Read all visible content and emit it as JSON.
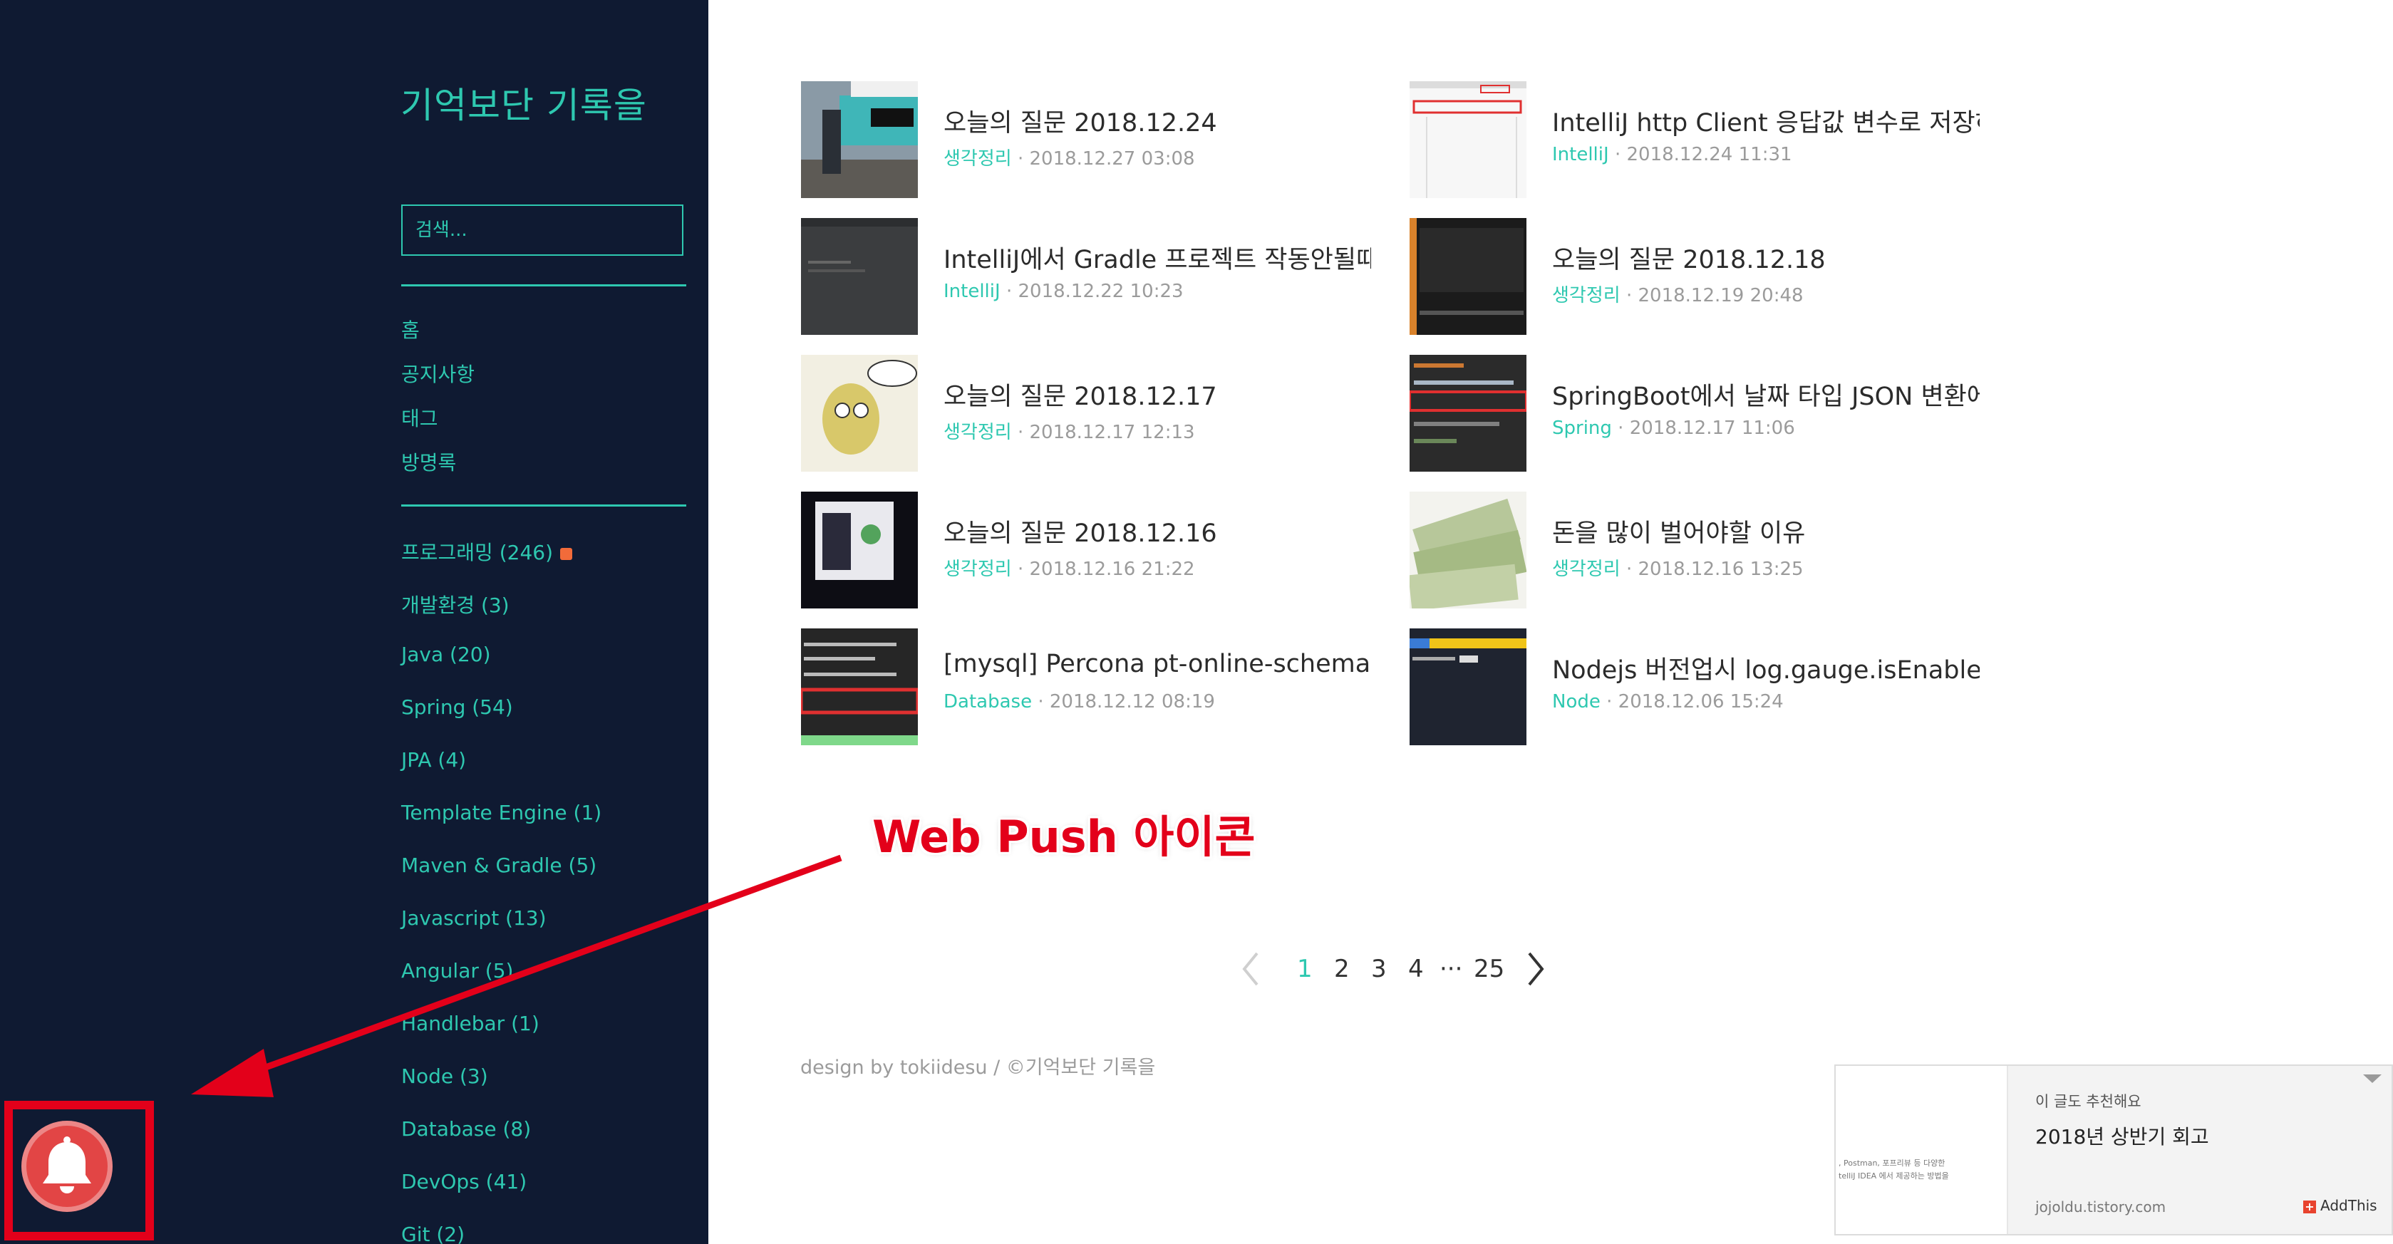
{
  "sidebar": {
    "blog_title": "기억보단 기록을",
    "search_placeholder": "검색...",
    "nav": [
      "홈",
      "공지사항",
      "태그",
      "방명록"
    ],
    "categories": [
      "프로그래밍 (246)",
      "개발환경 (3)",
      "Java (20)",
      "Spring (54)",
      "JPA (4)",
      "Template Engine (1)",
      "Maven & Gradle (5)",
      "Javascript (13)",
      "Angular (5)",
      "Handlebar (1)",
      "Node (3)",
      "Database (8)",
      "DevOps (41)",
      "Git (2)"
    ]
  },
  "posts": [
    {
      "title": "오늘의 질문 2018.12.24",
      "category": "생각정리",
      "date": "2018.12.27 03:08",
      "thumb_icon": "billboard-photo-thumbnail"
    },
    {
      "title": "IntelliJ http Client 응답값 변수로 저장하…",
      "category": "IntelliJ",
      "date": "2018.12.24 11:31",
      "thumb_icon": "ide-screenshot-thumbnail"
    },
    {
      "title": "IntelliJ에서 Gradle 프로젝트 작동안될때",
      "category": "IntelliJ",
      "date": "2018.12.22 10:23",
      "thumb_icon": "dark-ide-thumbnail"
    },
    {
      "title": "오늘의 질문 2018.12.18",
      "category": "생각정리",
      "date": "2018.12.19 20:48",
      "thumb_icon": "effective-debugging-book-thumbnail"
    },
    {
      "title": "오늘의 질문 2018.12.17",
      "category": "생각정리",
      "date": "2018.12.17 12:13",
      "thumb_icon": "cartoon-thumbnail"
    },
    {
      "title": "SpringBoot에서 날짜 타입 JSON 변환에 …",
      "category": "Spring",
      "date": "2018.12.17 11:06",
      "thumb_icon": "code-thumbnail"
    },
    {
      "title": "오늘의 질문 2018.12.16",
      "category": "생각정리",
      "date": "2018.12.16 21:22",
      "thumb_icon": "dashboard-thumbnail"
    },
    {
      "title": "돈을 많이 벌어야할 이유",
      "category": "생각정리",
      "date": "2018.12.16 13:25",
      "thumb_icon": "money-thumbnail"
    },
    {
      "title": "[mysql] Percona pt-online-schema-ch…",
      "category": "Database",
      "date": "2018.12.12 08:19",
      "thumb_icon": "terminal-thumbnail"
    },
    {
      "title": "Nodejs 버전업시 log.gauge.isEnabled …",
      "category": "Node",
      "date": "2018.12.06 15:24",
      "thumb_icon": "terminal-thumbnail"
    }
  ],
  "meta_separator": " · ",
  "pagination": {
    "pages": [
      "1",
      "2",
      "3",
      "4"
    ],
    "ellipsis": "···",
    "last": "25",
    "current": "1",
    "prev_icon": "chevron-left-icon",
    "next_icon": "chevron-right-icon"
  },
  "footer": "design by tokiidesu / ©기억보단 기록을",
  "annotation": "Web Push 아이콘",
  "recommend": {
    "label": "이 글도 추천해요",
    "title": "2018년 상반기 회고",
    "domain": "jojoldu.tistory.com",
    "addthis": "AddThis",
    "thumb_lines": [
      ", Postman, 포프리뷰 등 다양한",
      "telliJ IDEA 에서 제공하는 방법을"
    ]
  },
  "web_push_icon": "bell-icon",
  "colors": {
    "sidebar_bg": "#0f1a32",
    "accent": "#2ec8b0",
    "bell": "#e24545",
    "annotation_red": "#e3001a"
  }
}
